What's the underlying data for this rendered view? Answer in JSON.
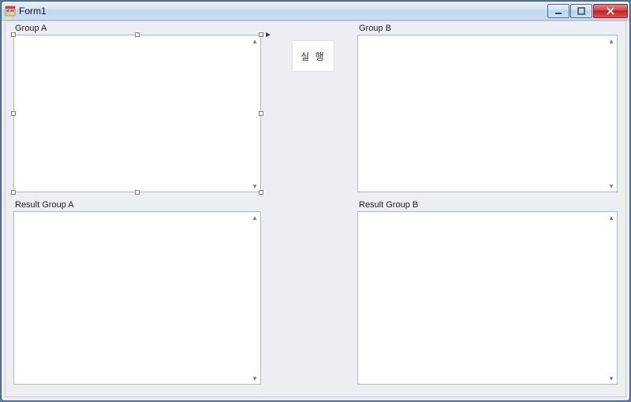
{
  "window": {
    "title": "Form1"
  },
  "labels": {
    "groupA": "Group A",
    "groupB": "Group B",
    "resultA": "Result Group A",
    "resultB": "Result Group B"
  },
  "button": {
    "run": "실 행"
  },
  "textboxes": {
    "groupA_value": "",
    "groupB_value": "",
    "resultA_value": "",
    "resultB_value": ""
  }
}
